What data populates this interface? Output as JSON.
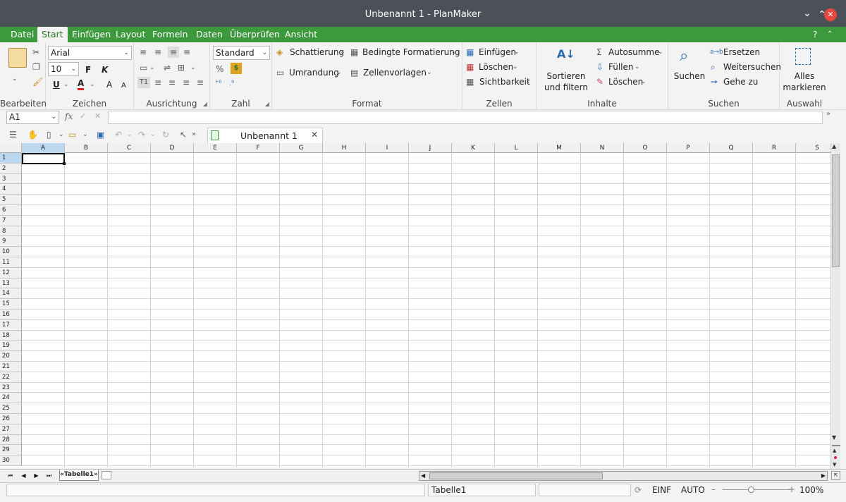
{
  "window": {
    "title": "Unbenannt 1 - PlanMaker"
  },
  "menubar": {
    "items": [
      "Datei",
      "Start",
      "Einfügen",
      "Layout",
      "Formeln",
      "Daten",
      "Überprüfen",
      "Ansicht"
    ],
    "active": "Start",
    "help": "?"
  },
  "ribbon": {
    "groups": {
      "bearbeiten": "Bearbeiten",
      "zeichen": "Zeichen",
      "ausrichtung": "Ausrichtung",
      "zahl": "Zahl",
      "format": "Format",
      "zellen": "Zellen",
      "inhalte": "Inhalte",
      "suchen": "Suchen",
      "auswahl": "Auswahl"
    },
    "font": {
      "name": "Arial",
      "size": "10",
      "bold": "F",
      "italic": "K",
      "underline": "U",
      "color_letter": "A",
      "color": "#e02020",
      "grow": "A",
      "shrink": "A"
    },
    "number_format": "Standard",
    "format": {
      "shading": "Schattierung",
      "conditional": "Bedingte Formatierung",
      "border": "Umrandung",
      "cell_styles": "Zellenvorlagen"
    },
    "cells": {
      "insert": "Einfügen",
      "delete": "Löschen",
      "visibility": "Sichtbarkeit"
    },
    "content": {
      "sort_line1": "Sortieren",
      "sort_line2": "und filtern",
      "autosum": "Autosumme",
      "fill": "Füllen",
      "clear": "Löschen"
    },
    "search": {
      "find": "Suchen",
      "replace": "Ersetzen",
      "find_next": "Weitersuchen",
      "goto": "Gehe zu"
    },
    "select": {
      "all_line1": "Alles",
      "all_line2": "markieren"
    }
  },
  "formula_bar": {
    "cell_ref": "A1",
    "fx": "fx",
    "value": ""
  },
  "document_tab": {
    "label": "Unbenannt 1"
  },
  "grid": {
    "columns": [
      "A",
      "B",
      "C",
      "D",
      "E",
      "F",
      "G",
      "H",
      "I",
      "J",
      "K",
      "L",
      "M",
      "N",
      "O",
      "P",
      "Q",
      "R",
      "S"
    ],
    "rows": [
      "1",
      "2",
      "3",
      "4",
      "5",
      "6",
      "7",
      "8",
      "9",
      "10",
      "11",
      "12",
      "13",
      "14",
      "15",
      "16",
      "17",
      "18",
      "19",
      "20",
      "21",
      "22",
      "23",
      "24",
      "25",
      "26",
      "27",
      "28",
      "29",
      "30"
    ],
    "active_cell": "A1"
  },
  "sheets": {
    "tabs": [
      "«Tabelle1»"
    ]
  },
  "statusbar": {
    "sheet": "Tabelle1",
    "mode_insert": "EINF",
    "mode_calc": "AUTO",
    "zoom": "100%",
    "zoom_minus": "–",
    "zoom_plus": "+"
  },
  "colors": {
    "menubar": "#3c9a3c",
    "titlebar": "#4c5058",
    "selection": "#bcd8f0"
  }
}
